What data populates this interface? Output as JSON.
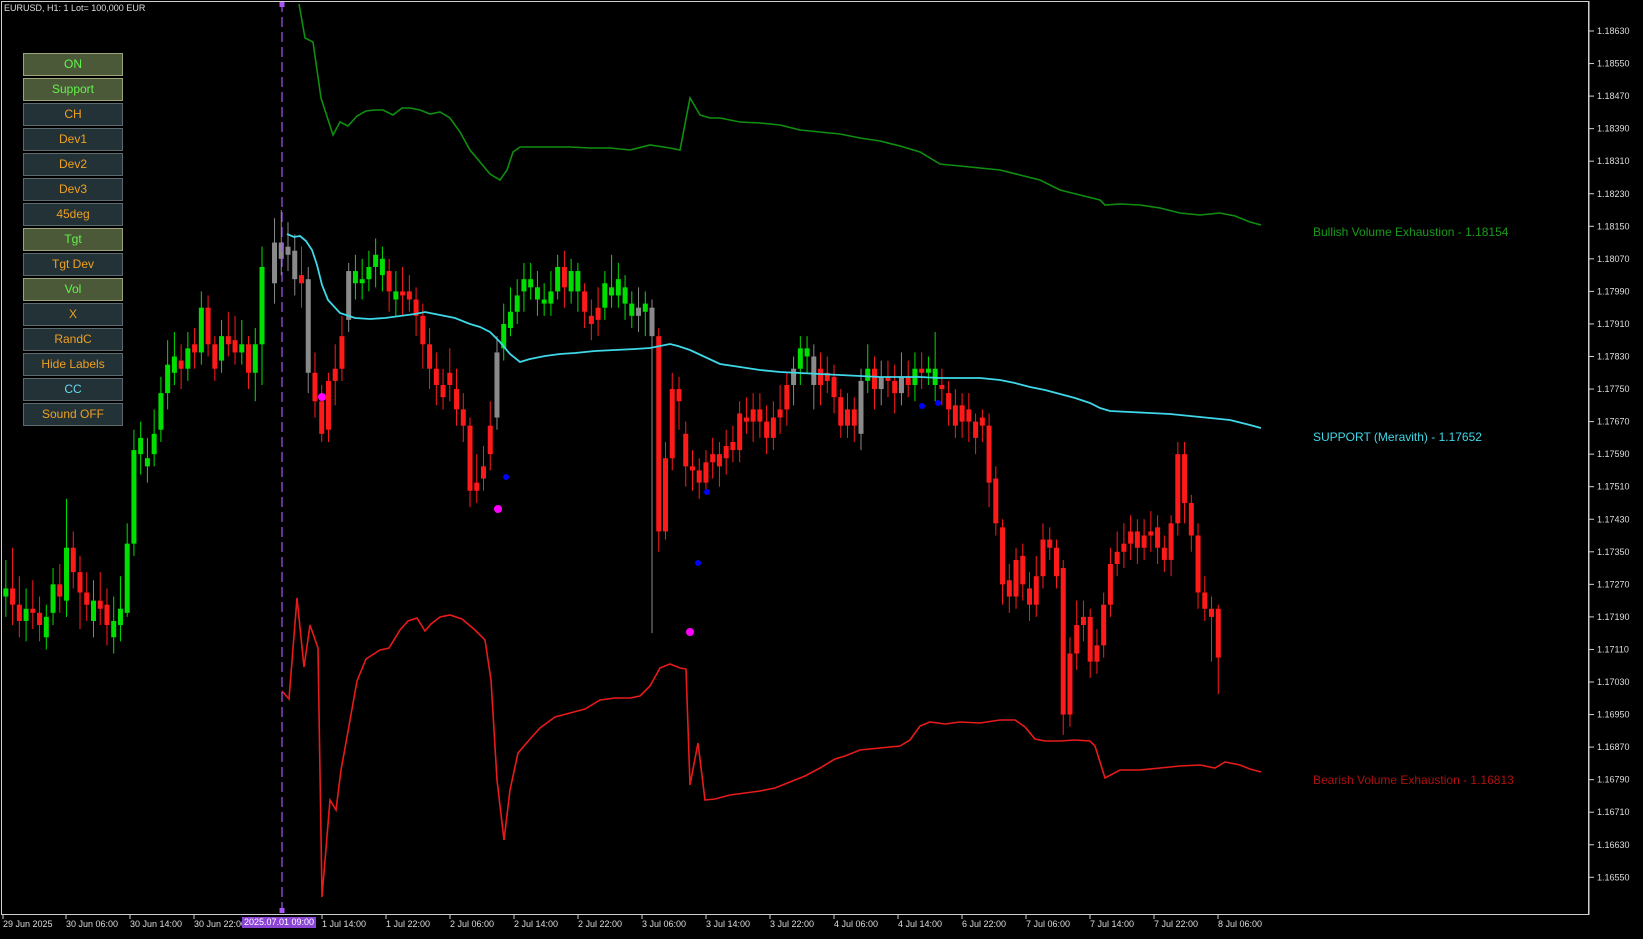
{
  "header": {
    "symbol_info": "EURUSD, H1:  1 Lot= 100,000 EUR"
  },
  "buttons": [
    {
      "label": "ON",
      "state": "on"
    },
    {
      "label": "Support",
      "state": "on"
    },
    {
      "label": "CH",
      "state": "off"
    },
    {
      "label": "Dev1",
      "state": "off"
    },
    {
      "label": "Dev2",
      "state": "off"
    },
    {
      "label": "Dev3",
      "state": "off"
    },
    {
      "label": "45deg",
      "state": "off"
    },
    {
      "label": "Tgt",
      "state": "on"
    },
    {
      "label": "Tgt Dev",
      "state": "off"
    },
    {
      "label": "Vol",
      "state": "on"
    },
    {
      "label": "X",
      "state": "off"
    },
    {
      "label": "RandC",
      "state": "off"
    },
    {
      "label": "Hide Labels",
      "state": "off"
    },
    {
      "label": "CC",
      "state": "cyan"
    },
    {
      "label": "Sound OFF",
      "state": "off"
    }
  ],
  "levels": {
    "bullish": "Bullish Volume Exhaustion - 1.18154",
    "support": "SUPPORT (Meravith) - 1.17652",
    "bearish": "Bearish Volume Exhaustion - 1.16813"
  },
  "price_axis": [
    "1.18630",
    "1.18550",
    "1.18470",
    "1.18390",
    "1.18310",
    "1.18230",
    "1.18150",
    "1.18070",
    "1.17990",
    "1.17910",
    "1.17830",
    "1.17750",
    "1.17670",
    "1.17590",
    "1.17510",
    "1.17430",
    "1.17350",
    "1.17270",
    "1.17190",
    "1.17110",
    "1.17030",
    "1.16950",
    "1.16870",
    "1.16790",
    "1.16710",
    "1.16630",
    "1.16550"
  ],
  "time_axis": [
    "29 Jun 2025",
    "30 Jun 06:00",
    "30 Jun 14:00",
    "30 Jun 22:00",
    "1 Jul 14:00",
    "1 Jul 22:00",
    "2 Jul 06:00",
    "2 Jul 14:00",
    "2 Jul 22:00",
    "3 Jul 06:00",
    "3 Jul 14:00",
    "3 Jul 22:00",
    "4 Jul 06:00",
    "4 Jul 14:00",
    "6 Jul 22:00",
    "7 Jul 06:00",
    "7 Jul 14:00",
    "7 Jul 22:00",
    "8 Jul 06:00"
  ],
  "time_highlight": "2025.07.01 09:00",
  "colors": {
    "bull_candle": "#00e000",
    "bear_candle": "#ff1a1a",
    "neutral_candle": "#8a8a8a",
    "bullish_line": "#0f8f0f",
    "support_line": "#3ed8e8",
    "bearish_line": "#e81a1a",
    "vline": "#a855f7"
  },
  "chart_data": {
    "type": "candlestick",
    "symbol": "EURUSD",
    "timeframe": "H1",
    "ylim": [
      1.1651,
      1.1868
    ],
    "levels": {
      "bullish_exhaustion": 1.18154,
      "support_meravith": 1.17652,
      "bearish_exhaustion": 1.16813
    }
  }
}
